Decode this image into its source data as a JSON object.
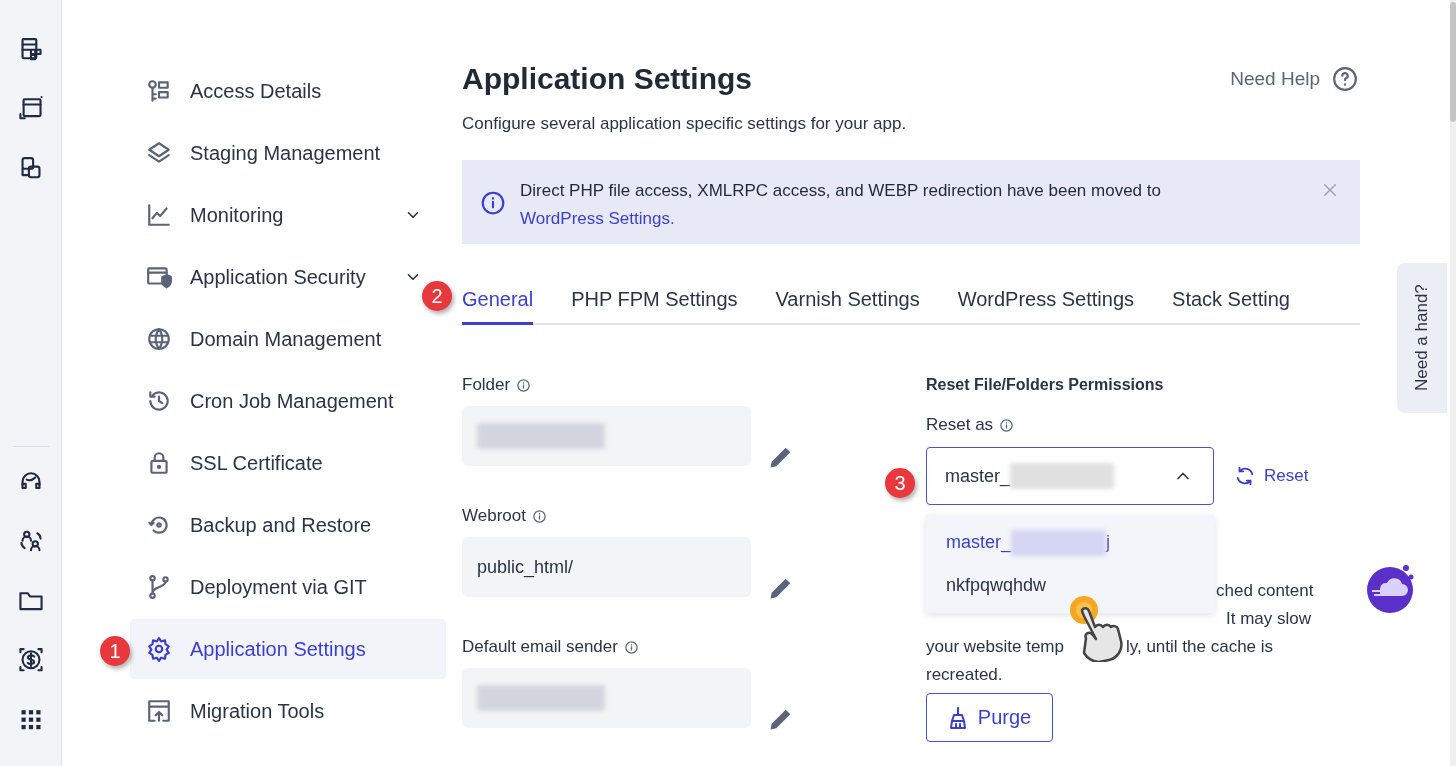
{
  "sidebar": {
    "items": [
      {
        "label": "Access Details",
        "selected": false,
        "has_submenu": false
      },
      {
        "label": "Staging Management",
        "selected": false,
        "has_submenu": false
      },
      {
        "label": "Monitoring",
        "selected": false,
        "has_submenu": true
      },
      {
        "label": "Application Security",
        "selected": false,
        "has_submenu": true
      },
      {
        "label": "Domain Management",
        "selected": false,
        "has_submenu": false
      },
      {
        "label": "Cron Job Management",
        "selected": false,
        "has_submenu": false
      },
      {
        "label": "SSL Certificate",
        "selected": false,
        "has_submenu": false
      },
      {
        "label": "Backup and Restore",
        "selected": false,
        "has_submenu": false
      },
      {
        "label": "Deployment via GIT",
        "selected": false,
        "has_submenu": false
      },
      {
        "label": "Application Settings",
        "selected": true,
        "has_submenu": false
      },
      {
        "label": "Migration Tools",
        "selected": false,
        "has_submenu": false
      }
    ]
  },
  "header": {
    "title": "Application Settings",
    "subtitle": "Configure several application specific settings for your app.",
    "help_link": "Need Help"
  },
  "notice": {
    "text": "Direct PHP file access, XMLRPC access, and WEBP redirection have been moved to",
    "link": "WordPress Settings."
  },
  "tabs": [
    {
      "label": "General",
      "selected": true
    },
    {
      "label": "PHP FPM Settings",
      "selected": false
    },
    {
      "label": "Varnish Settings",
      "selected": false
    },
    {
      "label": "WordPress Settings",
      "selected": false
    },
    {
      "label": "Stack Setting",
      "selected": false
    }
  ],
  "fields": [
    {
      "label": "Folder",
      "redacted": true
    },
    {
      "label": "Webroot",
      "value": "public_html/",
      "redacted": false
    },
    {
      "label": "Default email sender",
      "redacted": true
    }
  ],
  "permissions": {
    "heading": "Reset File/Folders Permissions",
    "reset_as_label": "Reset as",
    "select": {
      "value": "master_",
      "redacted": true,
      "expanded": true
    },
    "reset_button": "Reset",
    "options": [
      {
        "label": "master_",
        "suffix": "j",
        "redacted": true,
        "selected": true
      },
      {
        "label": "nkfpqwqhdw",
        "redacted": false,
        "selected": false
      }
    ]
  },
  "purge": {
    "lines": [
      [
        "ched content"
      ],
      [
        "It may slow"
      ],
      [
        "your website temp",
        "ly, until the cache is"
      ],
      [
        "recreated."
      ]
    ],
    "button": "Purge"
  },
  "side_tab": "Need a hand?",
  "annotations": [
    {
      "label": "1"
    },
    {
      "label": "2"
    },
    {
      "label": "3"
    }
  ]
}
